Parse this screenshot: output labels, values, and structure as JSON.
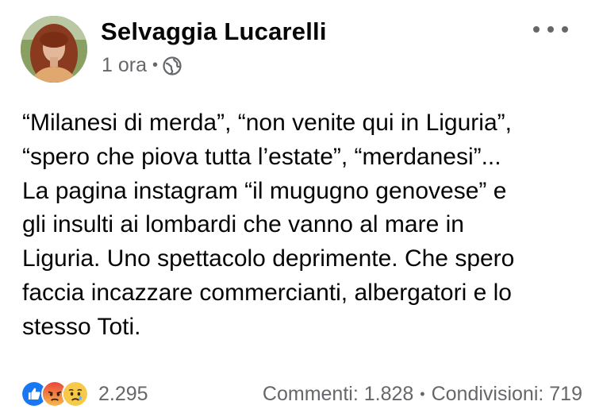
{
  "post": {
    "author": "Selvaggia Lucarelli",
    "time": "1 ora",
    "separator": "•",
    "privacy_icon": "globe-icon",
    "more_icon": "more-options-icon",
    "body_lines": [
      "“Milanesi di merda”, “non venite qui in Liguria”,",
      "“spero che piova tutta l’estate”, “merdanesi”...",
      "La pagina instagram “il mugugno genovese” e",
      "gli insulti ai lombardi che vanno al mare in",
      "Liguria. Uno spettacolo deprimente. Che spero",
      "faccia incazzare commercianti, albergatori e lo",
      "stesso Toti."
    ]
  },
  "footer": {
    "reaction_icons": [
      "like-reaction-icon",
      "angry-reaction-icon",
      "sad-reaction-icon"
    ],
    "reaction_count": "2.295",
    "comments": "Commenti: 1.828",
    "separator": "•",
    "shares": "Condivisioni: 719"
  },
  "colors": {
    "text_primary": "#050505",
    "text_secondary": "#65676b",
    "like_blue": "#1877f2",
    "angry_orange": "#f15b2a",
    "sad_yellow": "#f7c94b"
  }
}
